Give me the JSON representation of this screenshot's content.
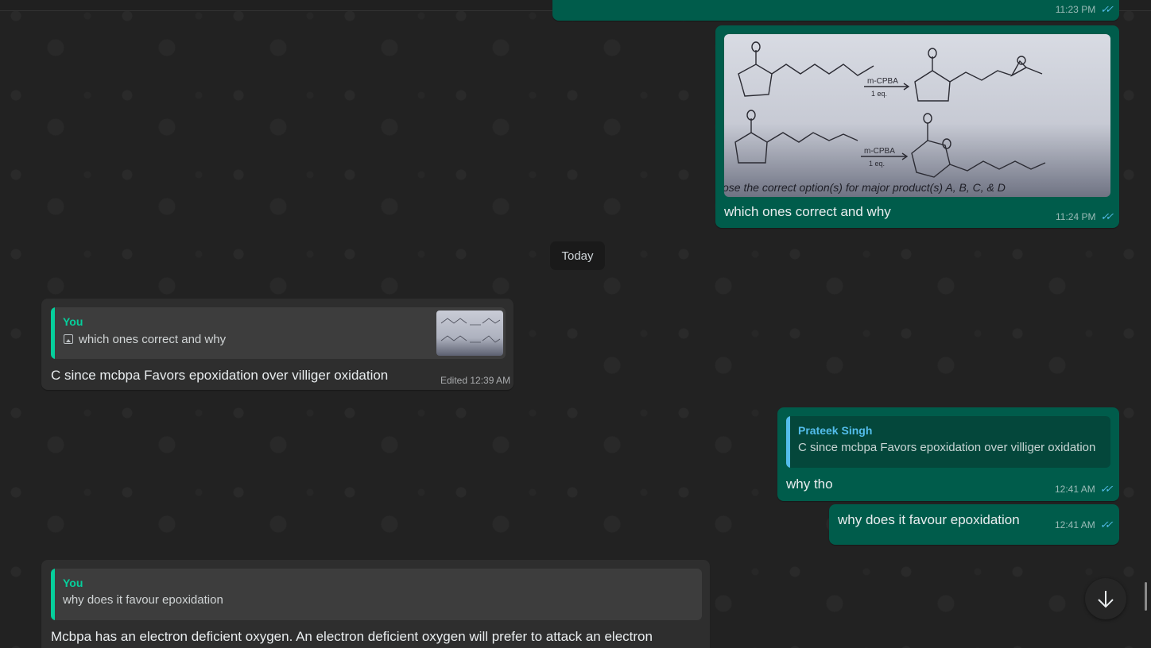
{
  "top_partial": {
    "time": "11:23 PM"
  },
  "image_message": {
    "caption": "which ones correct and why",
    "time": "11:24 PM",
    "photo_labels": {
      "reagent1": "m-CPBA",
      "eq1": "1 eq.",
      "reagent2": "m-CPBA",
      "eq2": "1 eq.",
      "bottom_text": "ose the correct option(s) for major product(s) A, B, C, & D"
    }
  },
  "date_divider": "Today",
  "reply_in_1": {
    "quote_author": "You",
    "quote_text": "which ones correct and why",
    "text": "C since mcbpa Favors  epoxidation over villiger oxidation",
    "meta": "Edited 12:39 AM"
  },
  "reply_out_1": {
    "quote_author": "Prateek Singh",
    "quote_text": "C since mcbpa Favors  epoxidation over villiger oxidation",
    "text": "why tho",
    "time": "12:41 AM"
  },
  "out_2": {
    "text": "why does it favour epoxidation",
    "time": "12:41 AM"
  },
  "reply_in_2": {
    "quote_author": "You",
    "quote_text": "why does it favour epoxidation",
    "text": "Mcbpa has an electron deficient oxygen. An electron deficient oxygen will prefer to attack an electron"
  },
  "colors": {
    "outgoing_bubble": "#005c4b",
    "incoming_bubble": "#2e2e2e",
    "quote_you": "#06cf9c",
    "quote_other": "#53bdeb",
    "ticks": "#53bdeb"
  },
  "icons": {
    "read_ticks": "double-check-icon",
    "image": "image-icon",
    "scroll": "arrow-down-icon"
  }
}
